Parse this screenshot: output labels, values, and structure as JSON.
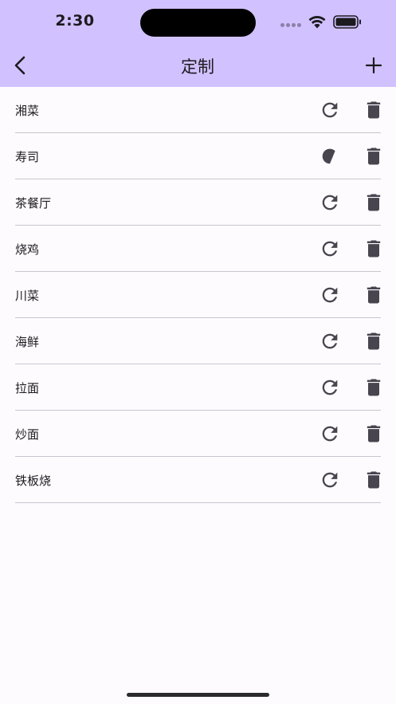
{
  "status_bar": {
    "time": "2:30"
  },
  "nav": {
    "title": "定制"
  },
  "items": [
    {
      "label": "湘菜"
    },
    {
      "label": "寿司"
    },
    {
      "label": "茶餐厅"
    },
    {
      "label": "烧鸡"
    },
    {
      "label": "川菜"
    },
    {
      "label": "海鲜"
    },
    {
      "label": "拉面"
    },
    {
      "label": "炒面"
    },
    {
      "label": "铁板烧"
    }
  ],
  "icons": {
    "back": "chevron-left-icon",
    "add": "plus-icon",
    "refresh": "refresh-icon",
    "delete": "trash-icon"
  },
  "colors": {
    "header_bg": "#d2c1ff",
    "page_bg": "#fefbff",
    "text": "#1b1b1f",
    "icon": "#49454f",
    "divider": "#c9c5cf"
  }
}
